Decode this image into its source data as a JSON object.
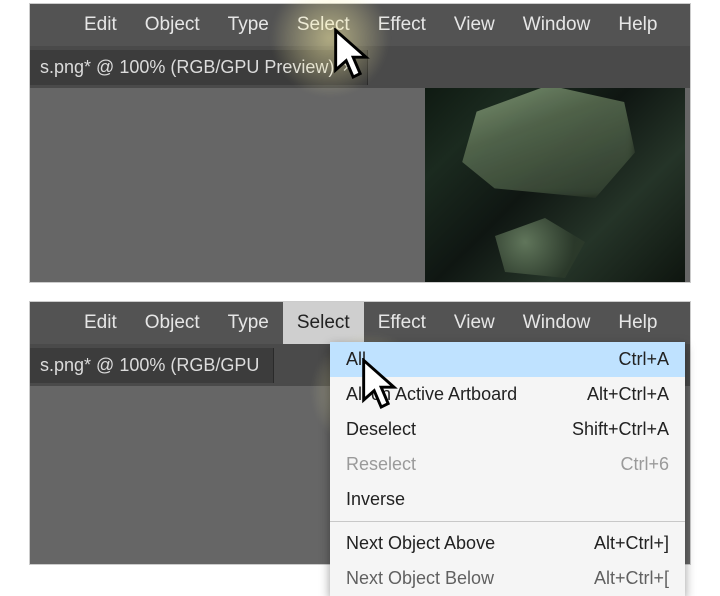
{
  "menubar": {
    "items": [
      "Edit",
      "Object",
      "Type",
      "Select",
      "Effect",
      "View",
      "Window",
      "Help"
    ]
  },
  "tab": {
    "label": "s.png* @ 100% (RGB/GPU Preview)",
    "label_truncated": "s.png* @ 100% (RGB/GPU",
    "close_glyph": "×"
  },
  "dropdown": {
    "items": [
      {
        "label": "All",
        "shortcut": "Ctrl+A",
        "highlight": true
      },
      {
        "label": "All on Active Artboard",
        "shortcut": "Alt+Ctrl+A"
      },
      {
        "label": "Deselect",
        "shortcut": "Shift+Ctrl+A"
      },
      {
        "label": "Reselect",
        "shortcut": "Ctrl+6",
        "disabled": true
      },
      {
        "label": "Inverse",
        "shortcut": ""
      }
    ],
    "after_sep": [
      {
        "label": "Next Object Above",
        "shortcut": "Alt+Ctrl+]"
      },
      {
        "label": "Next Object Below",
        "shortcut": "Alt+Ctrl+["
      }
    ]
  }
}
